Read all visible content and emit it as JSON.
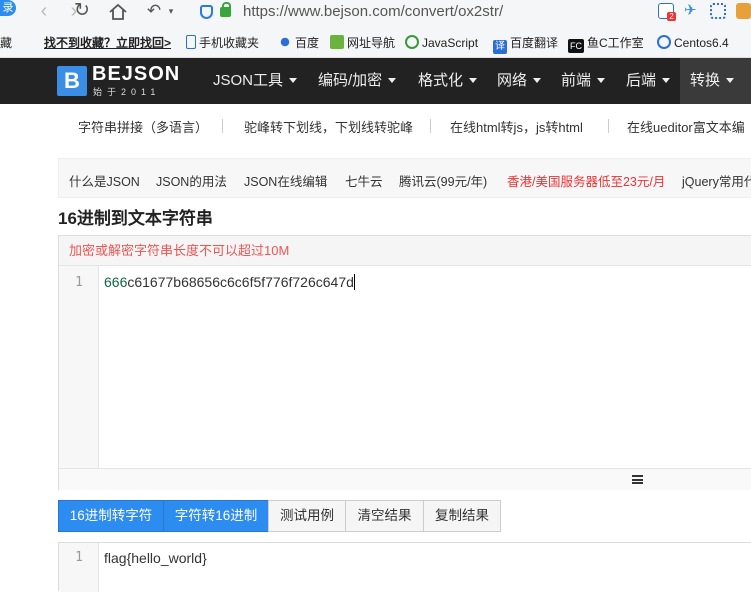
{
  "browser": {
    "login_badge": "录",
    "url": "https://www.bejson.com/convert/ox2str/",
    "notif_count": "2"
  },
  "bookmarks": [
    {
      "label": "藏",
      "icon": "star-icon"
    },
    {
      "label": "找不到收藏？立即找回>",
      "icon": ""
    },
    {
      "label": "手机收藏夹",
      "icon": "phone-icon"
    },
    {
      "label": "百度",
      "icon": "baidu-paw-icon"
    },
    {
      "label": "网址导航",
      "icon": "hao-icon"
    },
    {
      "label": "JavaScript",
      "icon": "eye-icon"
    },
    {
      "label": "百度翻译",
      "icon": "translate-icon"
    },
    {
      "label": "鱼C工作室",
      "icon": "fc-icon"
    },
    {
      "label": "Centos6.4",
      "icon": "centos-icon"
    }
  ],
  "site": {
    "logo_letter": "B",
    "logo_name": "BEJSON",
    "logo_sub": "始于2011",
    "nav": [
      "JSON工具",
      "编码/加密",
      "格式化",
      "网络",
      "前端",
      "后端",
      "转换"
    ]
  },
  "tools": [
    "字符串拼接（多语言）",
    "驼峰转下划线，下划线转驼峰",
    "在线html转js，js转html",
    "在线ueditor富文本编"
  ],
  "links": [
    "什么是JSON",
    "JSON的用法",
    "JSON在线编辑",
    "七牛云",
    "腾讯云(99元/年)",
    "香港/美国服务器低至23元/月",
    "jQuery常用代"
  ],
  "page": {
    "title": "16进制到文本字符串"
  },
  "editor1": {
    "warning": "加密或解密字符串长度不可以超过10M",
    "line_number": "1",
    "content_num": "666",
    "content_rest": "c61677b68656c6c6f5f776f726c647d"
  },
  "buttons": [
    "16进制转字符",
    "字符转16进制",
    "测试用例",
    "清空结果",
    "复制结果"
  ],
  "editor2": {
    "line_number": "1",
    "content": "flag{hello_world}"
  }
}
